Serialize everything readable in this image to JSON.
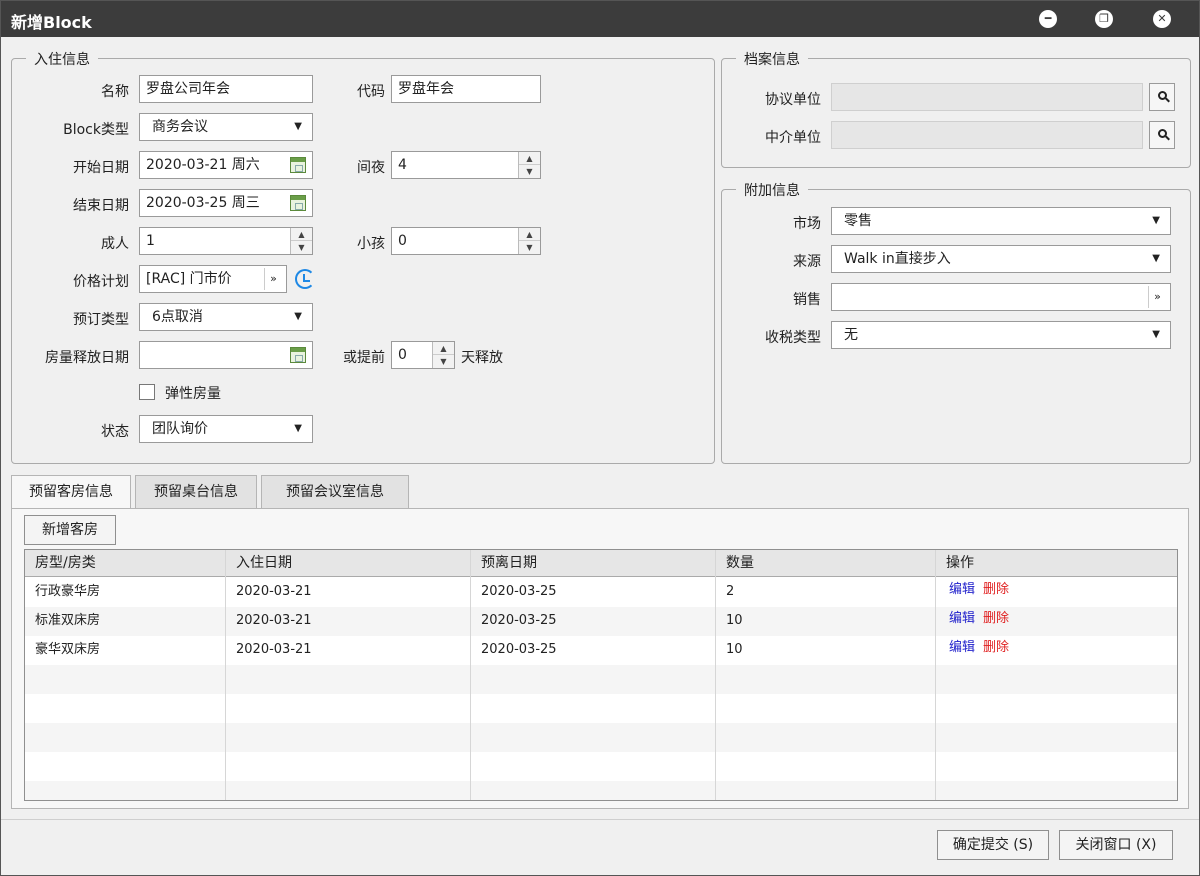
{
  "window": {
    "title": "新增Block"
  },
  "stay": {
    "legend": "入住信息",
    "name_label": "名称",
    "name_value": "罗盘公司年会",
    "code_label": "代码",
    "code_value": "罗盘年会",
    "block_type_label": "Block类型",
    "block_type_value": "商务会议",
    "start_label": "开始日期",
    "start_value": "2020-03-21 周六",
    "nights_label": "间夜",
    "nights_value": "4",
    "end_label": "结束日期",
    "end_value": "2020-03-25 周三",
    "adults_label": "成人",
    "adults_value": "1",
    "children_label": "小孩",
    "children_value": "0",
    "rate_label": "价格计划",
    "rate_value": "[RAC] 门市价",
    "booking_type_label": "预订类型",
    "booking_type_value": "6点取消",
    "release_label": "房量释放日期",
    "release_value": "",
    "advance_label": "或提前",
    "advance_value": "0",
    "advance_suffix": "天释放",
    "elastic_label": "弹性房量",
    "status_label": "状态",
    "status_value": "团队询价"
  },
  "profile": {
    "legend": "档案信息",
    "agreement_label": "协议单位",
    "agreement_value": "",
    "agent_label": "中介单位",
    "agent_value": ""
  },
  "extra": {
    "legend": "附加信息",
    "market_label": "市场",
    "market_value": "零售",
    "source_label": "来源",
    "source_value": "Walk in直接步入",
    "sales_label": "销售",
    "sales_value": "",
    "tax_label": "收税类型",
    "tax_value": "无"
  },
  "tabs": [
    "预留客房信息",
    "预留桌台信息",
    "预留会议室信息"
  ],
  "room_panel": {
    "add_button": "新增客房",
    "columns": [
      "房型/房类",
      "入住日期",
      "预离日期",
      "数量",
      "操作"
    ],
    "rows": [
      {
        "type": "行政豪华房",
        "checkin": "2020-03-21",
        "checkout": "2020-03-25",
        "qty": "2",
        "edit": "编辑",
        "delete": "删除"
      },
      {
        "type": "标准双床房",
        "checkin": "2020-03-21",
        "checkout": "2020-03-25",
        "qty": "10",
        "edit": "编辑",
        "delete": "删除"
      },
      {
        "type": "豪华双床房",
        "checkin": "2020-03-21",
        "checkout": "2020-03-25",
        "qty": "10",
        "edit": "编辑",
        "delete": "删除"
      }
    ]
  },
  "footer": {
    "confirm": "确定提交 (S)",
    "close": "关闭窗口 (X)"
  },
  "icons": {
    "minimize": "minimize-icon",
    "restore": "restore-icon",
    "close": "close-icon",
    "search": "search-icon",
    "calendar": "calendar-icon",
    "refresh": "refresh-icon"
  },
  "colors": {
    "titlebar": "#3c3c3c",
    "edit_link": "#2222cc",
    "delete_link": "#e02020",
    "refresh_icon": "#1e88e5"
  }
}
